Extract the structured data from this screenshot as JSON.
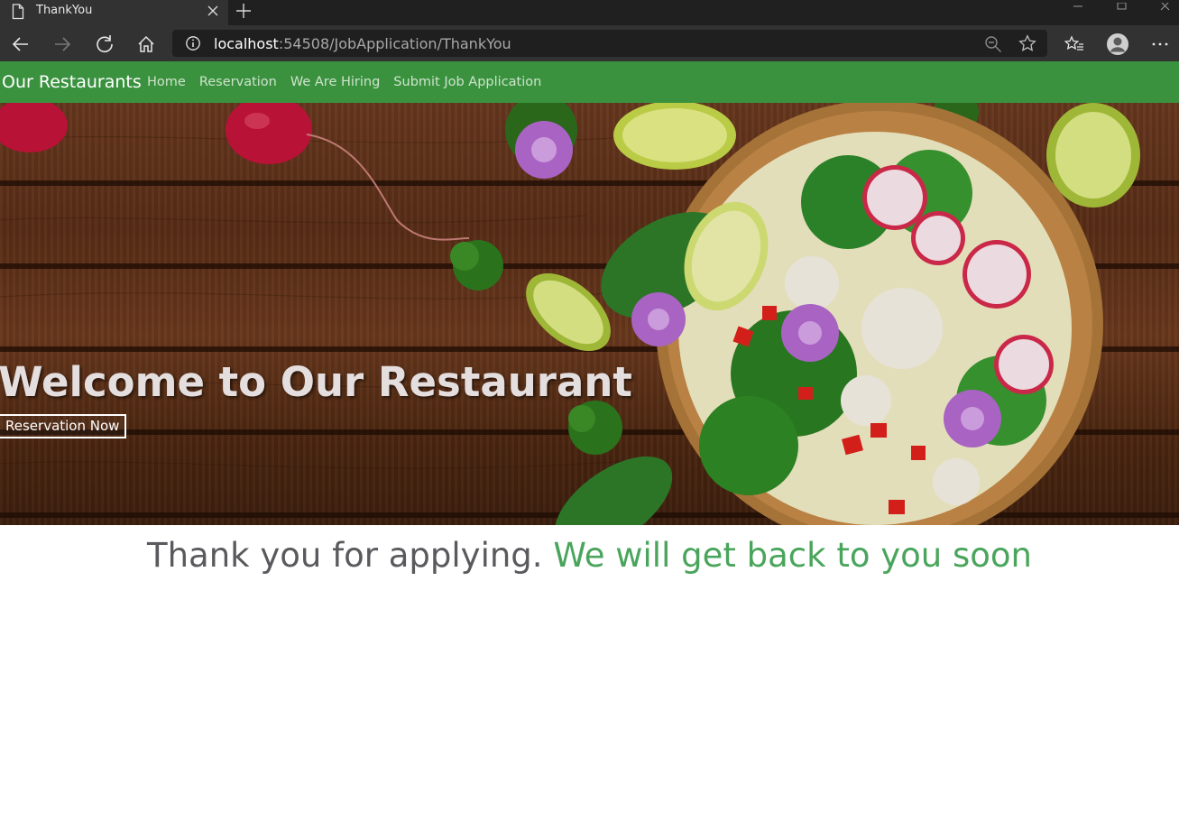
{
  "browser": {
    "tab_title": "ThankYou",
    "url_host": "localhost",
    "url_path": ":54508/JobApplication/ThankYou"
  },
  "site": {
    "brand": "Our Restaurants",
    "nav": {
      "home": "Home",
      "reservation": "Reservation",
      "hiring": "We Are Hiring",
      "submit": "Submit Job Application"
    },
    "nav_color": "#3a923f"
  },
  "hero": {
    "title": "Welcome to Our Restaurant",
    "button": "Reservation Now"
  },
  "message": {
    "part1": "Thank you for applying.",
    "part2": "We will get back to you soon",
    "part1_color": "#5a5a5e",
    "part2_color": "#4aa55c"
  }
}
